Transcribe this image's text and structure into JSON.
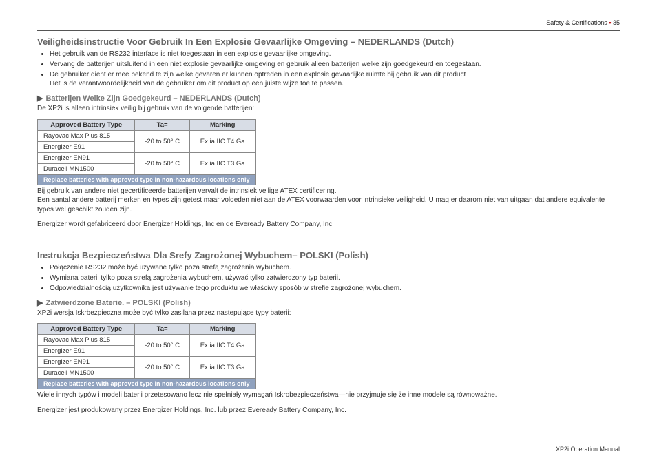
{
  "meta": {
    "section_label": "Safety & Certifications",
    "bullet": "•",
    "page": "35",
    "footer": "XP2i Operation Manual"
  },
  "dutch": {
    "title": "Veiligheidsinstructie Voor Gebruik In Een Explosie Gevaarlijke Omgeving – NEDERLANDS (Dutch)",
    "bullets": [
      "Het gebruik van de RS232 interface is niet toegestaan in een explosie gevaarlijke omgeving.",
      "Vervang de batterijen uitsluitend in een niet explosie gevaarlijke omgeving en gebruik alleen batterijen welke zijn goedgekeurd en toegestaan.",
      "De gebruiker dient er mee bekend te zijn welke gevaren er kunnen optreden in een explosie gevaarlijke ruimte bij gebruik van dit product",
      "Het is de verantwoordelijkheid van de gebruiker om dit product op een juiste wijze toe te passen."
    ],
    "sub_title": "Batterijen Welke Zijn Goedgekeurd – NEDERLANDS (Dutch)",
    "sub_intro": "De XP2i is alleen intrinsiek veilig bij gebruik van de volgende batterijen:",
    "para1": "Bij gebruik van andere niet gecertificeerde batterijen vervalt de intrinsiek veilige ATEX certificering.",
    "para2": "Een aantal andere batterij merken en types zijn getest maar voldeden niet aan de ATEX voorwaarden voor intrinsieke veiligheid, U mag er daarom niet van uitgaan dat andere equivalente types wel geschikt zouden zijn.",
    "para3": "Energizer wordt gefabriceerd door Energizer Holdings, Inc en de Eveready Battery Company, Inc"
  },
  "polish": {
    "title": "Instrukcja Bezpieczeństwa Dla Srefy Zagrożonej Wybuchem– POLSKI (Polish)",
    "bullets": [
      "Połączenie RS232 może być używane tylko poza strefą zagrożenia wybuchem.",
      "Wymiana baterii tylko poza strefą zagrożenia wybuchem, używać tylko zatwierdzony typ baterii.",
      "Odpowiedzialnością użytkownika jest używanie tego produktu we właściwy sposób w strefie zagrożonej wybuchem."
    ],
    "sub_title": "Zatwierdzone Baterie. – POLSKI (Polish)",
    "sub_intro": "XP2i wersja Iskrbezpieczna może być tylko zasilana przez nastepujące typy baterii:",
    "para1": "Wiele innych typów i modeli baterii przetesowano lecz nie spełniały wymagań Iskrobezpieczeństwa—nie przyjmuje się że inne modele są równoważne.",
    "para2": "Energizer jest produkowany przez Energizer Holdings, Inc. lub przez Eveready Battery Company, Inc."
  },
  "table": {
    "headers": {
      "col1": "Approved Battery Type",
      "col2": "Ta=",
      "col3": "Marking"
    },
    "rows": [
      {
        "type": "Rayovac Max Plus 815",
        "ta": "-20 to 50° C",
        "mark": "Ex ia IIC T4 Ga"
      },
      {
        "type": "Energizer E91"
      },
      {
        "type": "Energizer EN91",
        "ta": "-20 to 50° C",
        "mark": "Ex ia IIC T3 Ga"
      },
      {
        "type": "Duracell MN1500"
      }
    ],
    "replace_note": "Replace batteries with approved type in non-hazardous locations only"
  }
}
